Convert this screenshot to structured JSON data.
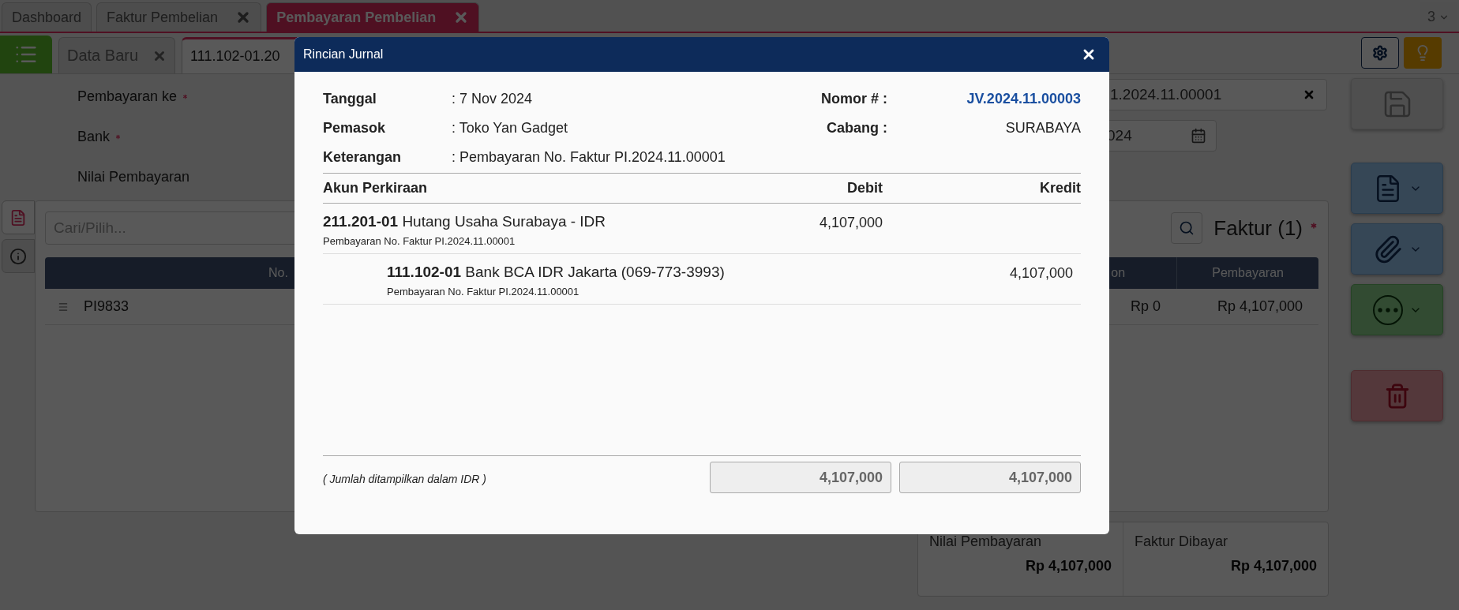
{
  "top_tabs": [
    {
      "label": "Dashboard",
      "closable": false,
      "selected": false
    },
    {
      "label": "Faktur Pembelian",
      "closable": true,
      "selected": false
    },
    {
      "label": "Pembayaran Pembelian",
      "closable": true,
      "selected": true
    }
  ],
  "tab_count": "3",
  "doc_tabs": [
    {
      "label": "Data Baru",
      "closable": true,
      "selected": false
    },
    {
      "label": "111.102-01.20",
      "closable": false,
      "selected": true
    }
  ],
  "form": {
    "labels": [
      {
        "text": "Pembayaran ke",
        "required": true
      },
      {
        "text": "Bank",
        "required": true
      },
      {
        "text": "Nilai Pembayaran",
        "required": false
      }
    ],
    "invoice_value": "1.2024.11.00001",
    "date_value": "024"
  },
  "card": {
    "search_placeholder": "Cari/Pilih...",
    "title": "Faktur (1)",
    "required": true,
    "columns": [
      "No.",
      "on",
      "Pembayaran"
    ],
    "rows": [
      [
        "PI9833",
        "Rp 0",
        "Rp 4,107,000"
      ]
    ]
  },
  "summary": [
    {
      "label": "Nilai Pembayaran",
      "value": "Rp 4,107,000"
    },
    {
      "label": "Faktur Dibayar",
      "value": "Rp 4,107,000"
    }
  ],
  "modal": {
    "title": "Rincian Jurnal",
    "info_left": [
      {
        "label": "Tanggal",
        "value": ": 7 Nov 2024"
      },
      {
        "label": "Pemasok",
        "value": ": Toko Yan Gadget"
      },
      {
        "label": "Keterangan",
        "value": ": Pembayaran No. Faktur PI.2024.11.00001"
      }
    ],
    "info_right": [
      {
        "label": "Nomor # :",
        "value": "JV.2024.11.00003",
        "kind": "link"
      },
      {
        "label": "Cabang :",
        "value": "SURABAYA",
        "kind": "text"
      }
    ],
    "columns": [
      "Akun Perkiraan",
      "Debit",
      "Kredit"
    ],
    "lines": [
      {
        "kind": "debit",
        "code": "211.201-01",
        "name": "Hutang Usaha Surabaya - IDR",
        "description": "Pembayaran No. Faktur PI.2024.11.00001",
        "amount": "4,107,000"
      },
      {
        "kind": "credit",
        "code": "111.102-01",
        "name": "Bank BCA IDR Jakarta (069-773-3993)",
        "description": "Pembayaran No. Faktur PI.2024.11.00001",
        "amount": "4,107,000"
      }
    ],
    "note": "( Jumlah ditampilkan dalam IDR )",
    "totals": [
      "4,107,000",
      "4,107,000"
    ]
  }
}
